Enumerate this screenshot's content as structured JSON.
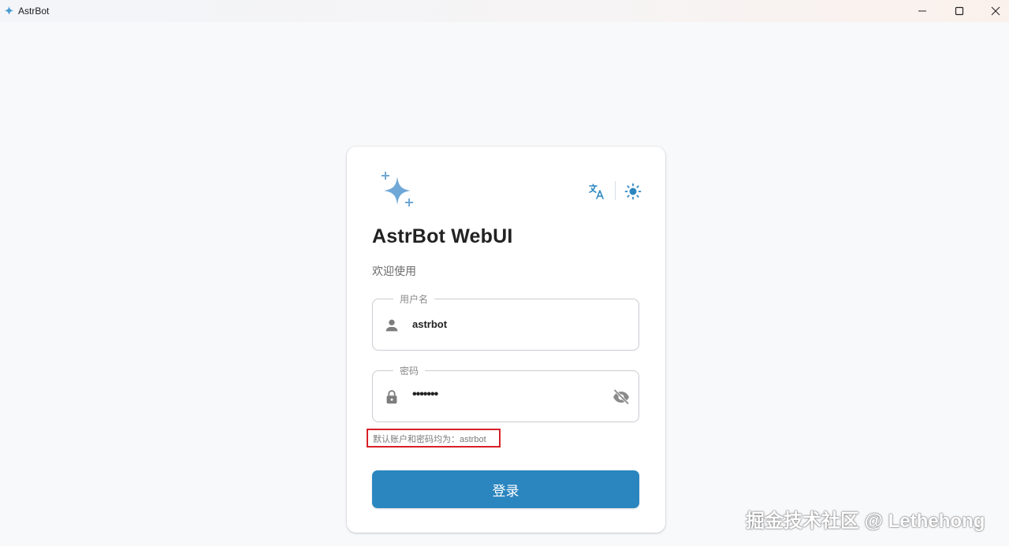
{
  "window": {
    "title": "AstrBot",
    "controls": [
      "minimize-icon",
      "maximize-icon",
      "close-icon"
    ]
  },
  "card": {
    "logo_icon": "sparkle-icon",
    "header_actions": [
      "translate-icon",
      "sun-icon"
    ],
    "title": "AstrBot WebUI",
    "subtitle": "欢迎使用"
  },
  "form": {
    "username": {
      "label": "用户名",
      "value": "astrbot",
      "icon": "person-icon"
    },
    "password": {
      "label": "密码",
      "value": "•••••••",
      "icon": "lock-icon",
      "toggle_icon": "eye-off-icon"
    },
    "hint": "默认账户和密码均为：astrbot",
    "submit_label": "登录"
  },
  "watermark": "掘金技术社区 @ Lethehong",
  "colors": {
    "accent": "#2b86c0",
    "logo": "#6fa8d6",
    "highlight_border": "#d62028",
    "background": "#f8f9fb"
  }
}
